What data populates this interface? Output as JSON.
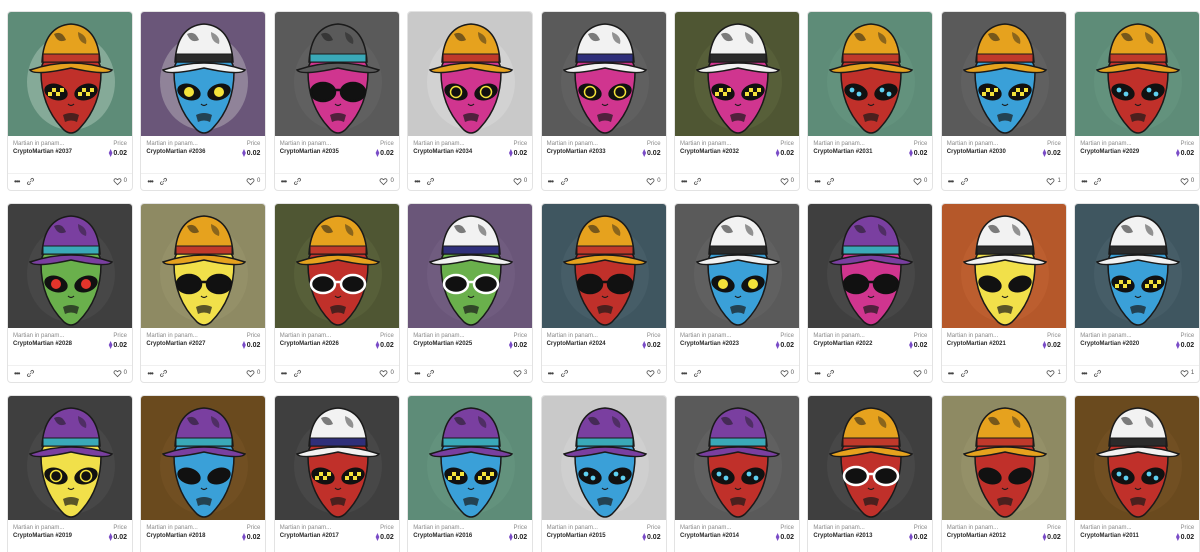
{
  "price_label": "Price",
  "eth_symbol": "⧫",
  "icons": {
    "more": "more-icon",
    "link": "link-icon",
    "like": "heart-icon",
    "currency": "eth-icon"
  },
  "cards": [
    {
      "collection": "Martian in panam...",
      "name": "CryptoMartian #2037",
      "price": "0.02",
      "likes": "0",
      "bg": "#5e8c78",
      "hat": "#e6a21e",
      "band": "#c0392b",
      "face": "#c0302a",
      "eye": "checker",
      "shade": "#cfe2d3"
    },
    {
      "collection": "Martian in panam...",
      "name": "CryptoMartian #2036",
      "price": "0.02",
      "likes": "0",
      "bg": "#6a5679",
      "hat": "#f2f2f2",
      "band": "#2b2b2b",
      "face": "#3aa0d8",
      "eye": "yellow",
      "shade": "#d8d8d8"
    },
    {
      "collection": "Martian in panam...",
      "name": "CryptoMartian #2035",
      "price": "0.02",
      "likes": "0",
      "bg": "#5a5a5a",
      "hat": "#5a5a5a",
      "band": "#3aa9b8",
      "face": "#d0358f",
      "eye": "shades",
      "shade": "#6c6c6c"
    },
    {
      "collection": "Martian in panam...",
      "name": "CryptoMartian #2034",
      "price": "0.02",
      "likes": "0",
      "bg": "#c9c9c9",
      "hat": "#e6a21e",
      "band": "#c0392b",
      "face": "#d0358f",
      "eye": "ring",
      "shade": "#e3e3e3"
    },
    {
      "collection": "Martian in panam...",
      "name": "CryptoMartian #2033",
      "price": "0.02",
      "likes": "0",
      "bg": "#5a5a5a",
      "hat": "#f2f2f2",
      "band": "#2f2f7a",
      "face": "#d0358f",
      "eye": "ring",
      "shade": "#6c6c6c"
    },
    {
      "collection": "Martian in panam...",
      "name": "CryptoMartian #2032",
      "price": "0.02",
      "likes": "0",
      "bg": "#4f5633",
      "hat": "#f2f2f2",
      "band": "#2b2b2b",
      "face": "#d0358f",
      "eye": "checker",
      "shade": "#676f45"
    },
    {
      "collection": "Martian in panam...",
      "name": "CryptoMartian #2031",
      "price": "0.02",
      "likes": "0",
      "bg": "#5e8c78",
      "hat": "#e6a21e",
      "band": "#c0392b",
      "face": "#c0302a",
      "eye": "dots",
      "shade": "#6e9e88"
    },
    {
      "collection": "Martian in panam...",
      "name": "CryptoMartian #2030",
      "price": "0.02",
      "likes": "1",
      "bg": "#5a5a5a",
      "hat": "#e6a21e",
      "band": "#c0392b",
      "face": "#3aa0d8",
      "eye": "checker",
      "shade": "#6c6c6c"
    },
    {
      "collection": "Martian in panam...",
      "name": "CryptoMartian #2029",
      "price": "0.02",
      "likes": "0",
      "bg": "#5e8c78",
      "hat": "#e6a21e",
      "band": "#c0392b",
      "face": "#c0302a",
      "eye": "dots",
      "shade": "#6e9e88"
    },
    {
      "collection": "Martian in panam...",
      "name": "CryptoMartian #2028",
      "price": "0.02",
      "likes": "0",
      "bg": "#3f3f3f",
      "hat": "#7a3fa0",
      "band": "#3aa9b8",
      "face": "#6ab04c",
      "eye": "red",
      "shade": "#555555"
    },
    {
      "collection": "Martian in panam...",
      "name": "CryptoMartian #2027",
      "price": "0.02",
      "likes": "0",
      "bg": "#8e8a63",
      "hat": "#e6a21e",
      "band": "#c0392b",
      "face": "#f1e04a",
      "eye": "shades",
      "shade": "#a19c72"
    },
    {
      "collection": "Martian in panam...",
      "name": "CryptoMartian #2026",
      "price": "0.02",
      "likes": "0",
      "bg": "#4f5633",
      "hat": "#e6a21e",
      "band": "#c0392b",
      "face": "#c0302a",
      "eye": "white-shades",
      "shade": "#676f45"
    },
    {
      "collection": "Martian in panam...",
      "name": "CryptoMartian #2025",
      "price": "0.02",
      "likes": "3",
      "bg": "#6a5679",
      "hat": "#f2f2f2",
      "band": "#2f2f7a",
      "face": "#6ab04c",
      "eye": "white-shades",
      "shade": "#7b688b"
    },
    {
      "collection": "Martian in panam...",
      "name": "CryptoMartian #2024",
      "price": "0.02",
      "likes": "0",
      "bg": "#3f5660",
      "hat": "#e6a21e",
      "band": "#c0392b",
      "face": "#c0302a",
      "eye": "shades",
      "shade": "#526b76"
    },
    {
      "collection": "Martian in panam...",
      "name": "CryptoMartian #2023",
      "price": "0.02",
      "likes": "0",
      "bg": "#5a5a5a",
      "hat": "#f2f2f2",
      "band": "#2b2b2b",
      "face": "#3aa0d8",
      "eye": "yellow",
      "shade": "#6c6c6c"
    },
    {
      "collection": "Martian in panam...",
      "name": "CryptoMartian #2022",
      "price": "0.02",
      "likes": "0",
      "bg": "#3f3f3f",
      "hat": "#7a3fa0",
      "band": "#3aa9b8",
      "face": "#d0358f",
      "eye": "shades",
      "shade": "#555555"
    },
    {
      "collection": "Martian in panam...",
      "name": "CryptoMartian #2021",
      "price": "0.02",
      "likes": "1",
      "bg": "#b5582a",
      "hat": "#f2f2f2",
      "band": "#2b2b2b",
      "face": "#f1e04a",
      "eye": "dark",
      "shade": "#c86a3a"
    },
    {
      "collection": "Martian in panam...",
      "name": "CryptoMartian #2020",
      "price": "0.02",
      "likes": "1",
      "bg": "#3f5660",
      "hat": "#f2f2f2",
      "band": "#2b2b2b",
      "face": "#3aa0d8",
      "eye": "checker",
      "shade": "#526b76"
    },
    {
      "collection": "Martian in panam...",
      "name": "CryptoMartian #2019",
      "price": "0.02",
      "likes": "",
      "bg": "#3f3f3f",
      "hat": "#7a3fa0",
      "band": "#3aa9b8",
      "face": "#f1e04a",
      "eye": "ring",
      "shade": "#555555"
    },
    {
      "collection": "Martian in panam...",
      "name": "CryptoMartian #2018",
      "price": "0.02",
      "likes": "",
      "bg": "#6a4a1e",
      "hat": "#7a3fa0",
      "band": "#3aa9b8",
      "face": "#3aa0d8",
      "eye": "dark",
      "shade": "#7d5a2a"
    },
    {
      "collection": "Martian in panam...",
      "name": "CryptoMartian #2017",
      "price": "0.02",
      "likes": "",
      "bg": "#3f3f3f",
      "hat": "#f2f2f2",
      "band": "#2f2f7a",
      "face": "#c0302a",
      "eye": "checker",
      "shade": "#555555"
    },
    {
      "collection": "Martian in panam...",
      "name": "CryptoMartian #2016",
      "price": "0.02",
      "likes": "",
      "bg": "#5e8c78",
      "hat": "#7a3fa0",
      "band": "#3aa9b8",
      "face": "#3aa0d8",
      "eye": "checker",
      "shade": "#6e9e88"
    },
    {
      "collection": "Martian in panam...",
      "name": "CryptoMartian #2015",
      "price": "0.02",
      "likes": "",
      "bg": "#c9c9c9",
      "hat": "#7a3fa0",
      "band": "#3aa9b8",
      "face": "#3aa0d8",
      "eye": "dots",
      "shade": "#dadada"
    },
    {
      "collection": "Martian in panam...",
      "name": "CryptoMartian #2014",
      "price": "0.02",
      "likes": "",
      "bg": "#5a5a5a",
      "hat": "#7a3fa0",
      "band": "#3aa9b8",
      "face": "#c0302a",
      "eye": "dots",
      "shade": "#6c6c6c"
    },
    {
      "collection": "Martian in panam...",
      "name": "CryptoMartian #2013",
      "price": "0.02",
      "likes": "",
      "bg": "#3f3f3f",
      "hat": "#e6a21e",
      "band": "#c0392b",
      "face": "#c0302a",
      "eye": "white-shades",
      "shade": "#555555"
    },
    {
      "collection": "Martian in panam...",
      "name": "CryptoMartian #2012",
      "price": "0.02",
      "likes": "",
      "bg": "#8e8a63",
      "hat": "#e6a21e",
      "band": "#c0392b",
      "face": "#c0302a",
      "eye": "dark",
      "shade": "#a19c72"
    },
    {
      "collection": "Martian in panam...",
      "name": "CryptoMartian #2011",
      "price": "0.02",
      "likes": "",
      "bg": "#6a4a1e",
      "hat": "#f2f2f2",
      "band": "#2b2b2b",
      "face": "#c0302a",
      "eye": "dots",
      "shade": "#7d5a2a"
    }
  ]
}
